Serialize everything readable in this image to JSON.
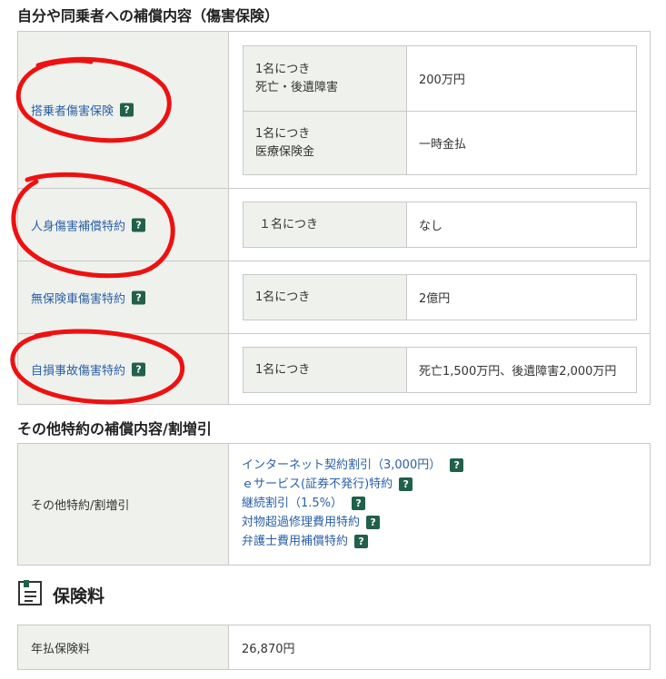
{
  "injury_section": {
    "title": "自分や同乗者への補償内容（傷害保険）",
    "rows": [
      {
        "label": "搭乗者傷害保険",
        "items": [
          {
            "key_line1": "1名につき",
            "key_line2": "死亡・後遺障害",
            "value": "200万円"
          },
          {
            "key_line1": "1名につき",
            "key_line2": "医療保険金",
            "value": "一時金払"
          }
        ]
      },
      {
        "label": "人身傷害補償特約",
        "items": [
          {
            "key_line1": "１名につき",
            "value": "なし"
          }
        ]
      },
      {
        "label": "無保険車傷害特約",
        "items": [
          {
            "key_line1": "1名につき",
            "value": "2億円"
          }
        ]
      },
      {
        "label": "自損事故傷害特約",
        "items": [
          {
            "key_line1": "1名につき",
            "value": "死亡1,500万円、後遺障害2,000万円"
          }
        ]
      }
    ],
    "help_icon": "?"
  },
  "other_section": {
    "title": "その他特約の補償内容/割増引",
    "label": "その他特約/割増引",
    "links": [
      "インターネット契約割引（3,000円）",
      "ｅサービス(証券不発行)特約",
      "継続割引（1.5%）",
      "対物超過修理費用特約",
      "弁護士費用補償特約"
    ]
  },
  "premium_section": {
    "icon": "document-icon",
    "title": "保険料",
    "label": "年払保険料",
    "value": "26,870円"
  },
  "colors": {
    "link": "#2a5fa8",
    "help_icon_bg": "#21604a",
    "label_bg": "#eef1ec",
    "annotation_red": "#ee1111"
  }
}
